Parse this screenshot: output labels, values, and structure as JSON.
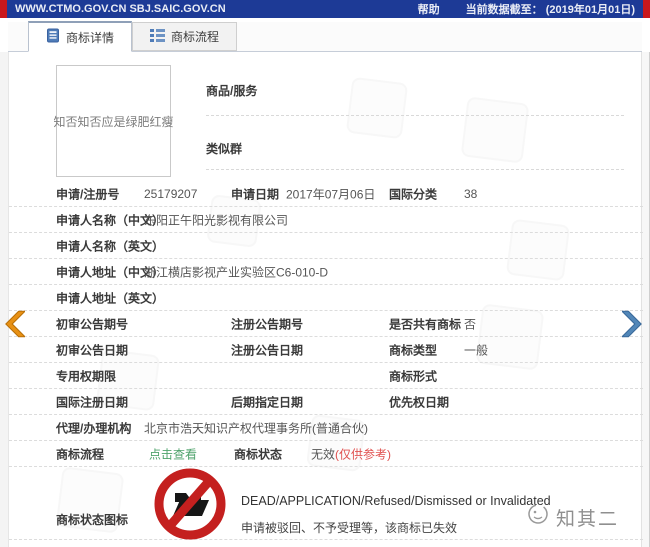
{
  "topbar": {
    "domains": "WWW.CTMO.GOV.CN SBJ.SAIC.GOV.CN",
    "help": "帮助",
    "data_cutoff": "当前数据截至： (2019年01月01日)"
  },
  "tabs": {
    "details": "商标详情",
    "process": "商标流程"
  },
  "trademark_image": {
    "text": "知否知否应是绿肥红瘦"
  },
  "goods_section": {
    "goods_label": "商品/服务",
    "similar_group_label": "类似群"
  },
  "fields": {
    "reg_no": {
      "label": "申请/注册号",
      "value": "25179207"
    },
    "app_date": {
      "label": "申请日期",
      "value": "2017年07月06日"
    },
    "intl_class": {
      "label": "国际分类",
      "value": "38"
    },
    "applicant_cn": {
      "label": "申请人名称（中文）",
      "value": "东阳正午阳光影视有限公司"
    },
    "applicant_en": {
      "label": "申请人名称（英文）",
      "value": ""
    },
    "address_cn": {
      "label": "申请人地址（中文）",
      "value": "浙江横店影视产业实验区C6-010-D"
    },
    "address_en": {
      "label": "申请人地址（英文）",
      "value": ""
    },
    "first_notice_no": {
      "label": "初审公告期号",
      "value": ""
    },
    "reg_notice_no": {
      "label": "注册公告期号",
      "value": ""
    },
    "is_shared": {
      "label": "是否共有商标",
      "value": "否"
    },
    "first_notice_date": {
      "label": "初审公告日期",
      "value": ""
    },
    "reg_notice_date": {
      "label": "注册公告日期",
      "value": ""
    },
    "mark_type": {
      "label": "商标类型",
      "value": "一般"
    },
    "exclusive_period": {
      "label": "专用权期限",
      "value": ""
    },
    "mark_form": {
      "label": "商标形式",
      "value": ""
    },
    "intl_reg_date": {
      "label": "国际注册日期",
      "value": ""
    },
    "late_designated_date": {
      "label": "后期指定日期",
      "value": ""
    },
    "priority_date": {
      "label": "优先权日期",
      "value": ""
    },
    "agency": {
      "label": "代理/办理机构",
      "value": "北京市浩天知识产权代理事务所(普通合伙)"
    },
    "process": {
      "label": "商标流程",
      "link": "点击查看"
    },
    "status": {
      "label": "商标状态",
      "value": "无效",
      "note": "(仅供参考)"
    }
  },
  "status_icon_section": {
    "label": "商标状态图标",
    "status_en": "DEAD/APPLICATION/Refused/Dismissed or Invalidated",
    "status_cn": "申请被驳回、不予受理等，该商标已失效"
  },
  "watermark": {
    "brand": "知其二"
  },
  "icons": {
    "details_tab": "notebook-icon",
    "process_tab": "list-icon",
    "status": "prohibited-folder-icon",
    "brand": "face-logo-icon",
    "nav_left": "chevron-left-icon",
    "nav_right": "chevron-right-icon"
  },
  "colors": {
    "topbar_blue": "#1d3a96",
    "corner_red": "#c8171b",
    "link_green": "#4fa36c",
    "status_red": "#e0514f",
    "prohibit_red": "#c4201f",
    "arrow_left_orange": "#e89114",
    "arrow_right_blue": "#5287b8"
  }
}
